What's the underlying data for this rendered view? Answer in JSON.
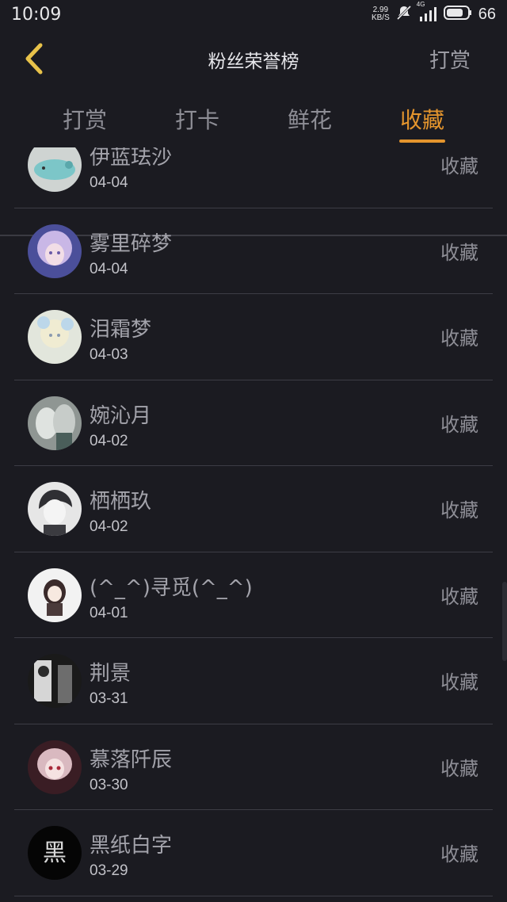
{
  "status_bar": {
    "time": "10:09",
    "net_speed_value": "2.99",
    "net_speed_unit": "KB/S",
    "signal_label": "4G",
    "battery": "66"
  },
  "header": {
    "title": "粉丝荣誉榜",
    "action_label": "打赏",
    "back_icon": "chevron-left-icon",
    "accent_color": "#e4952d"
  },
  "tabs": [
    {
      "label": "打赏",
      "active": false
    },
    {
      "label": "打卡",
      "active": false
    },
    {
      "label": "鲜花",
      "active": false
    },
    {
      "label": "收藏",
      "active": true
    }
  ],
  "list": {
    "items": [
      {
        "name": "伊蓝珐沙",
        "date": "04-04",
        "type": "收藏"
      },
      {
        "name": "雾里碎梦",
        "date": "04-04",
        "type": "收藏"
      },
      {
        "name": "泪霜梦",
        "date": "04-03",
        "type": "收藏"
      },
      {
        "name": "婉沁月",
        "date": "04-02",
        "type": "收藏"
      },
      {
        "name": "栖栖玖",
        "date": "04-02",
        "type": "收藏"
      },
      {
        "name": "(^_^)寻觅(^_^)",
        "date": "04-01",
        "type": "收藏"
      },
      {
        "name": "荆景",
        "date": "03-31",
        "type": "收藏"
      },
      {
        "name": "慕落阡辰",
        "date": "03-30",
        "type": "收藏"
      },
      {
        "name": "黑纸白字",
        "date": "03-29",
        "type": "收藏"
      }
    ]
  }
}
